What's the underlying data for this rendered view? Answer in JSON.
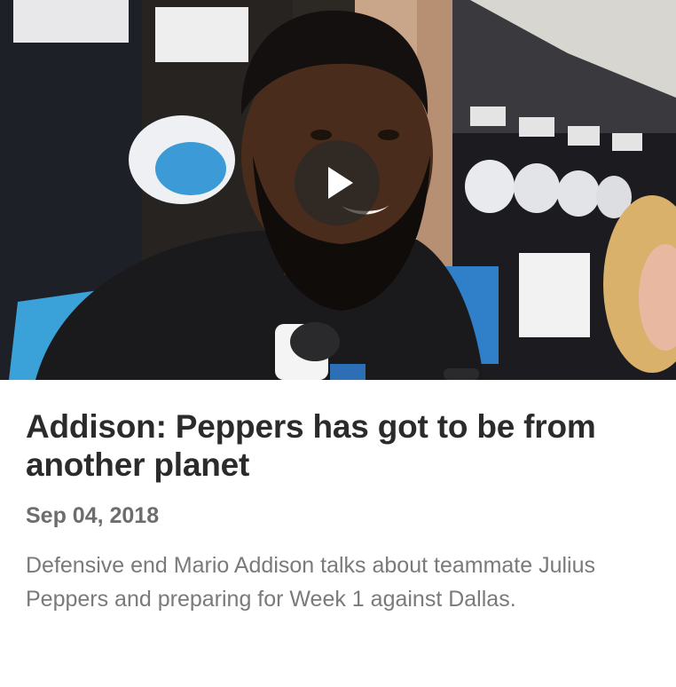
{
  "video": {
    "thumbnail_icon": "video-thumbnail-image",
    "play_icon": "play-icon"
  },
  "article": {
    "title": "Addison: Peppers has got to be from another planet",
    "date": "Sep 04, 2018",
    "description": "Defensive end Mario Addison talks about teammate Julius Peppers and preparing for Week 1 against Dallas."
  },
  "colors": {
    "title": "#2b2b2b",
    "date": "#6d6d6d",
    "description": "#7a7a7a",
    "background": "#ffffff",
    "play_button_bg": "#282828"
  }
}
